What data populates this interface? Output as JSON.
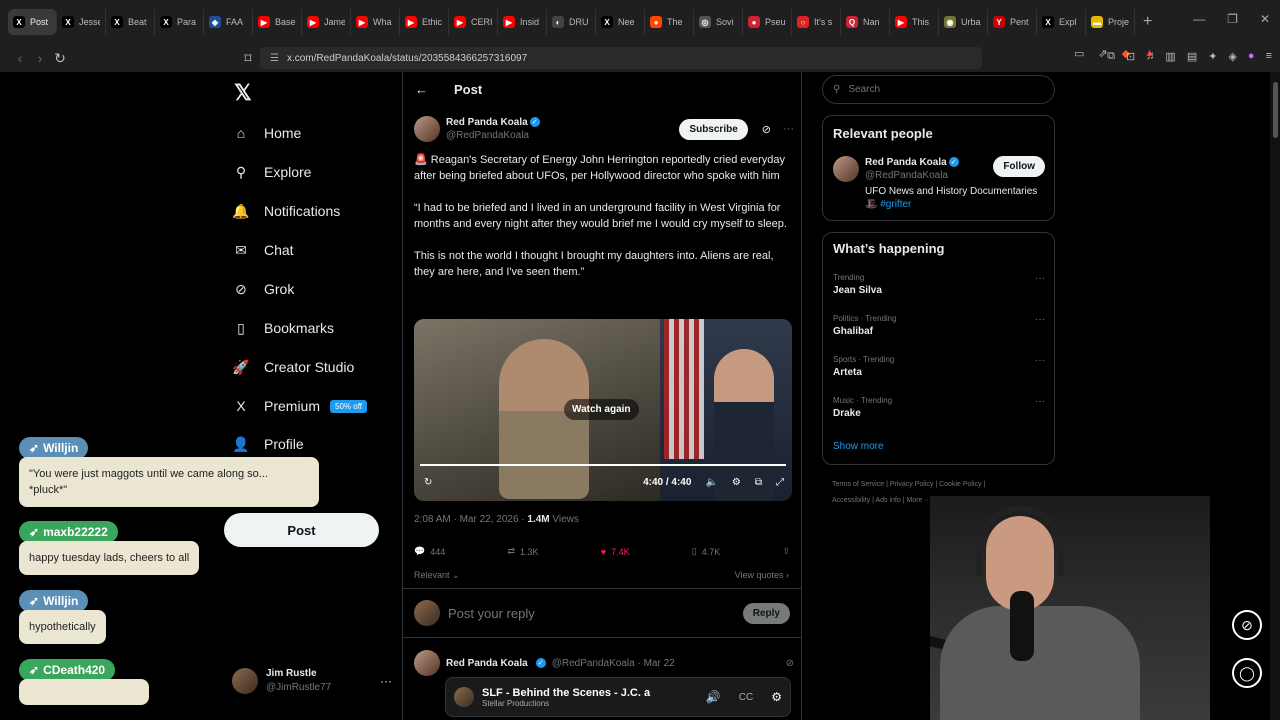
{
  "browser": {
    "tabs": [
      {
        "title": "Post",
        "fav": "X",
        "color": "#000000",
        "active": true
      },
      {
        "title": "Jesse",
        "fav": "X",
        "color": "#000000"
      },
      {
        "title": "Beat",
        "fav": "X",
        "color": "#000000"
      },
      {
        "title": "Para",
        "fav": "X",
        "color": "#000000"
      },
      {
        "title": "FAA",
        "fav": "◆",
        "color": "#1f4e99"
      },
      {
        "title": "Base",
        "fav": "▶",
        "color": "#ff0000"
      },
      {
        "title": "Jame",
        "fav": "▶",
        "color": "#ff0000"
      },
      {
        "title": "Wha",
        "fav": "▶",
        "color": "#ff0000"
      },
      {
        "title": "Ethic",
        "fav": "▶",
        "color": "#ff0000"
      },
      {
        "title": "CERI",
        "fav": "▶",
        "color": "#ff0000"
      },
      {
        "title": "Insid",
        "fav": "▶",
        "color": "#ff0000"
      },
      {
        "title": "DRU",
        "fav": "◐",
        "color": "#444444"
      },
      {
        "title": "Nee",
        "fav": "X",
        "color": "#000000"
      },
      {
        "title": "The",
        "fav": "●",
        "color": "#ff4500"
      },
      {
        "title": "Sovi",
        "fav": "◎",
        "color": "#555555"
      },
      {
        "title": "Pseu",
        "fav": "●",
        "color": "#cc2233"
      },
      {
        "title": "It's s",
        "fav": "○",
        "color": "#dd2222"
      },
      {
        "title": "Nan",
        "fav": "Q",
        "color": "#cc2233"
      },
      {
        "title": "This",
        "fav": "▶",
        "color": "#ff0000"
      },
      {
        "title": "Urba",
        "fav": "◉",
        "color": "#777733"
      },
      {
        "title": "Pent",
        "fav": "Y",
        "color": "#cc0000"
      },
      {
        "title": "Expl",
        "fav": "X",
        "color": "#000000"
      },
      {
        "title": "Proje",
        "fav": "▬",
        "color": "#e6b800"
      }
    ],
    "url": "x.com/RedPandaKoala/status/2035584366257316097"
  },
  "nav": {
    "items": [
      {
        "label": "Home",
        "icon": "⌂"
      },
      {
        "label": "Explore",
        "icon": "⚲"
      },
      {
        "label": "Notifications",
        "icon": "🔔"
      },
      {
        "label": "Chat",
        "icon": "✉"
      },
      {
        "label": "Grok",
        "icon": "⊘"
      },
      {
        "label": "Bookmarks",
        "icon": "▯"
      },
      {
        "label": "Creator Studio",
        "icon": "🚀"
      },
      {
        "label": "Premium",
        "icon": "X"
      },
      {
        "label": "Profile",
        "icon": "👤"
      }
    ],
    "premium_badge": "50% off",
    "post_button": "Post",
    "account": {
      "name": "Jim Rustle",
      "handle": "@JimRustle77"
    }
  },
  "post": {
    "header": "Post",
    "author_name": "Red Panda Koala",
    "author_handle": "@RedPandaKoala",
    "subscribe": "Subscribe",
    "paragraphs": [
      "🚨 Reagan's Secretary of Energy John Herrington reportedly cried everyday after being briefed about UFOs, per Hollywood director who spoke with him",
      "“I had to be briefed and I lived in an underground facility in West Virginia for months and every night after they would brief me I would cry myself to sleep.",
      "This is not the world I thought I brought my daughters into.  Aliens are real, they are here, and I've seen them.”"
    ],
    "video": {
      "watch_again": "Watch again",
      "time": "4:40 / 4:40",
      "progress": 1.0
    },
    "timestamp": "2:08 AM · Mar 22, 2026 · ",
    "views_count": "1.4M",
    "views_label": " Views",
    "replies": "444",
    "reposts": "1.3K",
    "likes": "7.4K",
    "bookmarks": "4.7K",
    "sort": "Relevant",
    "view_quotes": "View quotes",
    "reply_placeholder": "Post your reply",
    "reply_button": "Reply",
    "reply2": {
      "name": "Red Panda Koala",
      "handle": "@RedPandaKoala · Mar 22"
    },
    "embed": {
      "title": "SLF - Behind the Scenes - J.C. a",
      "source": "Stellar Productions"
    }
  },
  "sidebar": {
    "search_placeholder": "Search",
    "relevant_title": "Relevant people",
    "person": {
      "name": "Red Panda Koala",
      "handle": "@RedPandaKoala",
      "bio": "UFO News and History Documentaries",
      "tag": "#grifter",
      "follow": "Follow"
    },
    "happening_title": "What’s happening",
    "trends": [
      {
        "context": "Trending",
        "name": "Jean Silva"
      },
      {
        "context": "Politics · Trending",
        "name": "Ghalibaf"
      },
      {
        "context": "Sports · Trending",
        "name": "Arteta"
      },
      {
        "context": "Music · Trending",
        "name": "Drake"
      }
    ],
    "show_more": "Show more",
    "footer_line1": "Terms of Service  |  Privacy Policy  |  Cookie Policy  |",
    "footer_line2": "Accessibility  |  Ads info  |  More ···  © 2026 X Corp."
  },
  "chat": [
    {
      "user": "Willjin",
      "color": "#5b8fb5",
      "message": "\"You were just maggots until we came along so... *pluck*\""
    },
    {
      "user": "maxb22222",
      "color": "#3aa55c",
      "message": "happy tuesday lads, cheers to all"
    },
    {
      "user": "Willjin",
      "color": "#5b8fb5",
      "message": "hypothetically"
    },
    {
      "user": "CDeath420",
      "color": "#3aa55c",
      "message": ""
    }
  ]
}
